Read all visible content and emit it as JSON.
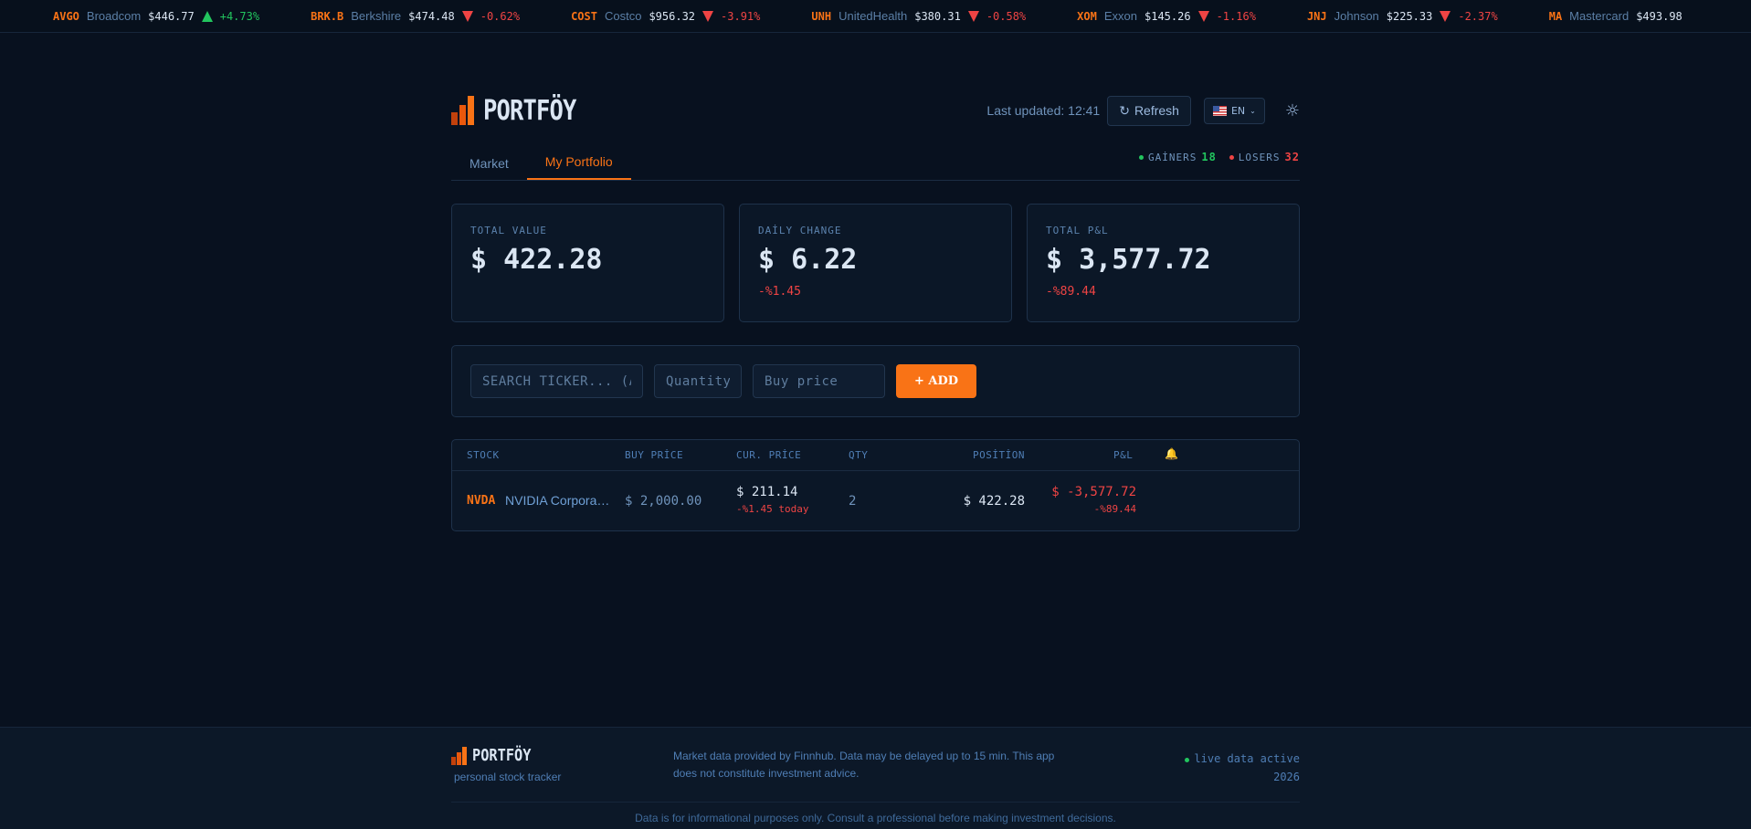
{
  "ticker": [
    {
      "symbol": "AVGO",
      "name": "Broadcom",
      "price": "$446.77",
      "change": "+4.73%",
      "direction": "up"
    },
    {
      "symbol": "BRK.B",
      "name": "Berkshire",
      "price": "$474.48",
      "change": "-0.62%",
      "direction": "down"
    },
    {
      "symbol": "COST",
      "name": "Costco",
      "price": "$956.32",
      "change": "-3.91%",
      "direction": "down"
    },
    {
      "symbol": "UNH",
      "name": "UnitedHealth",
      "price": "$380.31",
      "change": "-0.58%",
      "direction": "down"
    },
    {
      "symbol": "XOM",
      "name": "Exxon",
      "price": "$145.26",
      "change": "-1.16%",
      "direction": "down"
    },
    {
      "symbol": "JNJ",
      "name": "Johnson",
      "price": "$225.33",
      "change": "-2.37%",
      "direction": "down"
    },
    {
      "symbol": "MA",
      "name": "Mastercard",
      "price": "$493.98",
      "change": "",
      "direction": ""
    }
  ],
  "header": {
    "brand": "PORTFÖY",
    "last_updated": "Last updated: 12:41",
    "refresh_label": "Refresh",
    "refresh_icon": "↻",
    "language": "EN",
    "theme_icon": "☼"
  },
  "tabs": [
    {
      "label": "Market",
      "active": false
    },
    {
      "label": "My Portfolio",
      "active": true
    }
  ],
  "stats": {
    "gainers_label": "GAİNERS",
    "gainers_value": "18",
    "losers_label": "LOSERS",
    "losers_value": "32"
  },
  "cards": [
    {
      "label": "TOTAL VALUE",
      "value": "$ 422.28",
      "sub": ""
    },
    {
      "label": "DAİLY CHANGE",
      "value": "$ 6.22",
      "sub": "-%1.45"
    },
    {
      "label": "TOTAL P&L",
      "value": "$ 3,577.72",
      "sub": "-%89.44"
    }
  ],
  "form": {
    "ticker_placeholder": "SEARCH TİCKER... (AA",
    "quantity_placeholder": "Quantity",
    "price_placeholder": "Buy price",
    "add_label": "+ ADD"
  },
  "table": {
    "headers": {
      "stock": "STOCK",
      "buy_price": "BUY PRİCE",
      "cur_price": "CUR. PRİCE",
      "qty": "QTY",
      "position": "POSİTİON",
      "pnl": "P&L",
      "alert_icon": "🔔"
    },
    "rows": [
      {
        "symbol": "NVDA",
        "name": "NVIDIA Corporation",
        "buy_price": "$ 2,000.00",
        "cur_price": "$ 211.14",
        "cur_change": "-%1.45 today",
        "qty": "2",
        "position": "$ 422.28",
        "pnl": "$ -3,577.72",
        "pnl_pct": "-%89.44"
      }
    ]
  },
  "footer": {
    "brand": "PORTFÖY",
    "tagline": "personal stock tracker",
    "disclaimer": "Market data provided by Finnhub. Data may be delayed up to 15 min. This app does not constitute investment advice.",
    "live": "live data active",
    "year": "2026",
    "note": "Data is for informational purposes only. Consult a professional before making investment decisions."
  },
  "colors": {
    "accent": "#f97316",
    "up": "#22c55e",
    "down": "#ef4444",
    "background": "#08111f"
  }
}
